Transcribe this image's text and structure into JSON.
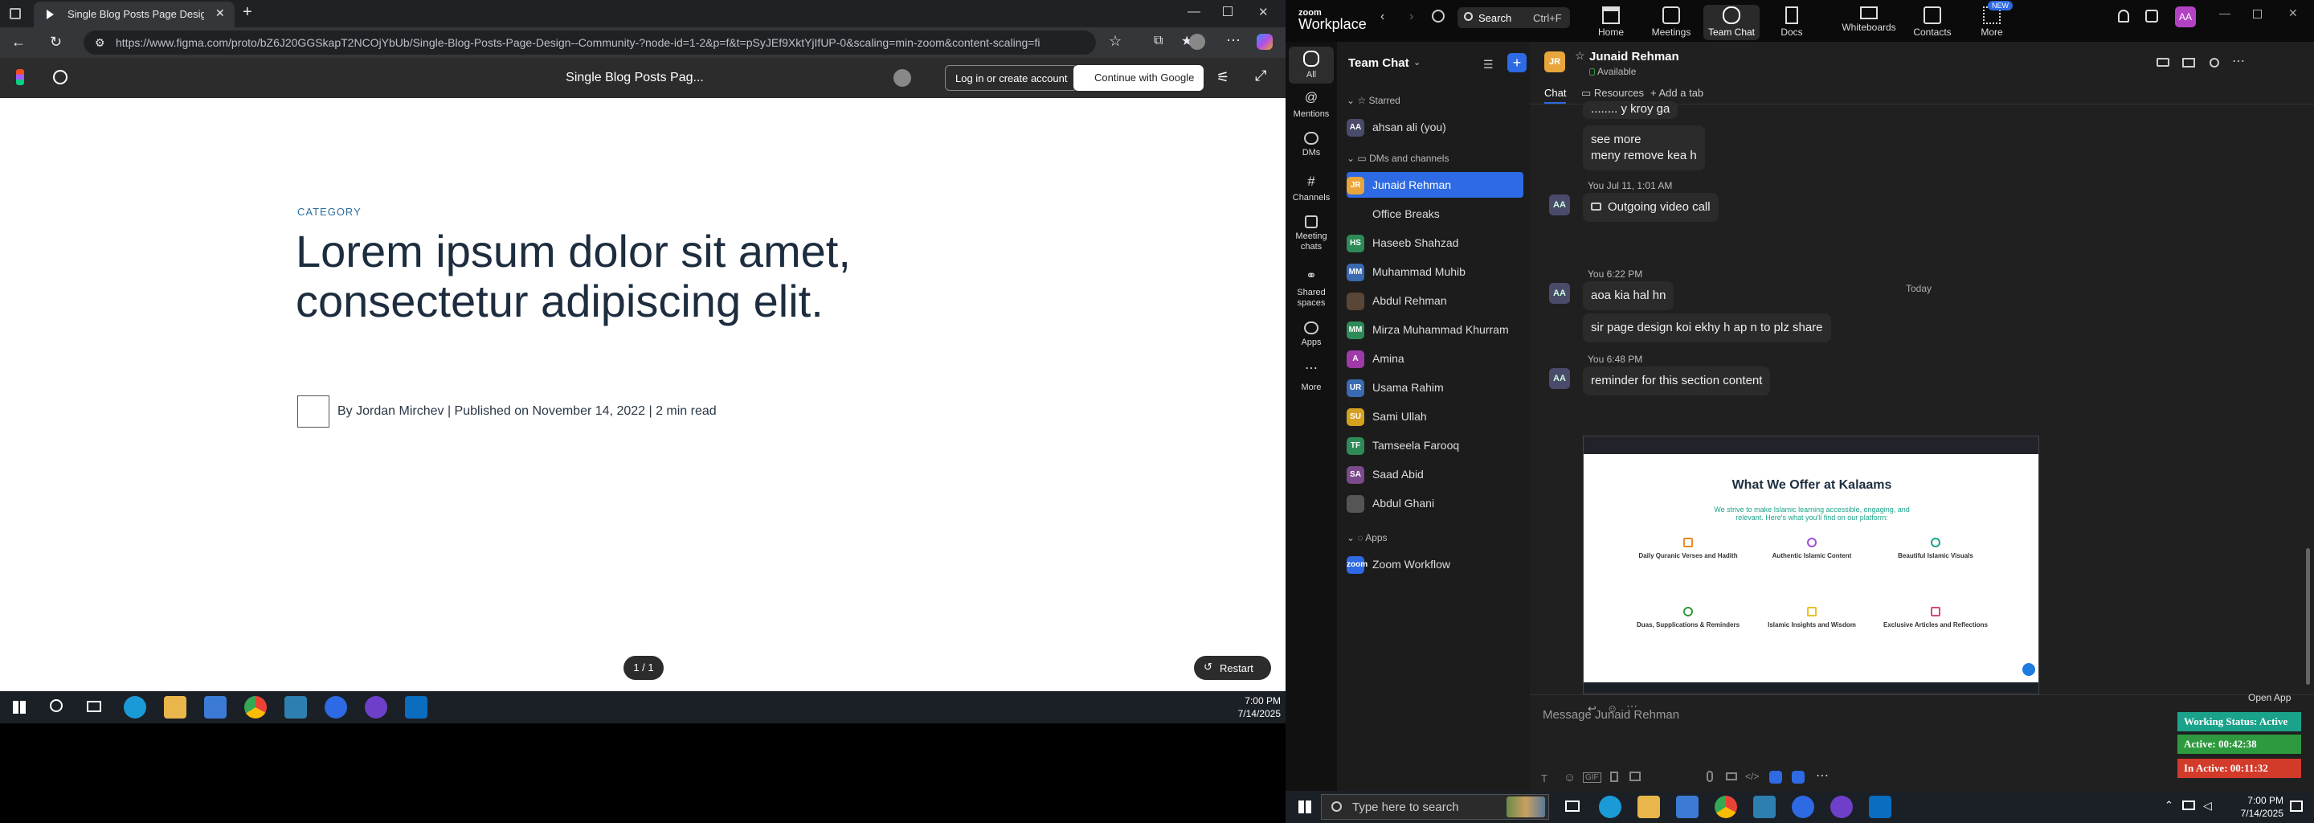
{
  "browser": {
    "tab_title": "Single Blog Posts Page Design (C",
    "url": "https://www.figma.com/proto/bZ6J20GGSkapT2NCOjYbUb/Single-Blog-Posts-Page-Design--Community-?node-id=1-2&p=f&t=pSyJEf9XktYjIfUP-0&scaling=min-zoom&content-scaling=fi",
    "figma_title": "Single Blog Posts Pag...",
    "login_label": "Log in or create account",
    "google_label": "Continue with Google"
  },
  "blog": {
    "category": "CATEGORY",
    "headline": "Lorem ipsum dolor sit amet, consectetur adipiscing elit.",
    "byline": "By Jordan Mirchev  |  Published on November 14, 2022  |  2 min read",
    "pager": "1 / 1",
    "restart": "Restart"
  },
  "left_taskbar": {
    "time": "7:00 PM",
    "date": "7/14/2025"
  },
  "zoom": {
    "logo_top": "zoom",
    "logo_bottom": "Workplace",
    "search_label": "Search",
    "search_shortcut": "Ctrl+F",
    "tabs": [
      {
        "label": "Home"
      },
      {
        "label": "Meetings"
      },
      {
        "label": "Team Chat"
      },
      {
        "label": "Docs"
      },
      {
        "label": "Whiteboards"
      },
      {
        "label": "Contacts"
      },
      {
        "label": "More"
      }
    ],
    "new_badge": "NEW",
    "user_initials": "AA",
    "rail": [
      {
        "label": "All"
      },
      {
        "label": "Mentions"
      },
      {
        "label": "DMs"
      },
      {
        "label": "Channels"
      },
      {
        "label": "Meeting chats"
      },
      {
        "label": "Shared spaces"
      },
      {
        "label": "Apps"
      },
      {
        "label": "More"
      }
    ],
    "list_title": "Team Chat",
    "sections": {
      "starred": "Starred",
      "dms": "DMs and channels",
      "apps": "Apps"
    },
    "starred_items": [
      {
        "name": "ahsan ali (you)",
        "initials": "AA",
        "color": "#4a4a6a"
      }
    ],
    "dm_items": [
      {
        "name": "Junaid Rehman",
        "initials": "JR",
        "color": "#e8a53c"
      },
      {
        "name": "Office Breaks",
        "initials": "",
        "color": "#1c1c1c"
      },
      {
        "name": "Haseeb Shahzad",
        "initials": "HS",
        "color": "#2e8b57"
      },
      {
        "name": "Muhammad Muhib",
        "initials": "MM",
        "color": "#3a6ab0"
      },
      {
        "name": "Abdul Rehman",
        "initials": "",
        "color": "#5a4636"
      },
      {
        "name": "Mirza Muhammad Khurram",
        "initials": "MM",
        "color": "#2e8b57"
      },
      {
        "name": "Amina",
        "initials": "A",
        "color": "#a03aa8"
      },
      {
        "name": "Usama Rahim",
        "initials": "UR",
        "color": "#3a6ab0"
      },
      {
        "name": "Sami Ullah",
        "initials": "SU",
        "color": "#d4a020"
      },
      {
        "name": "Tamseela Farooq",
        "initials": "TF",
        "color": "#2e8b57"
      },
      {
        "name": "Saad Abid",
        "initials": "SA",
        "color": "#7a4a8a"
      },
      {
        "name": "Abdul Ghani",
        "initials": "",
        "color": "#555"
      }
    ],
    "app_items": [
      {
        "name": "Zoom Workflow",
        "initials": "zoom",
        "color": "#2d6ae3"
      }
    ],
    "chat": {
      "contact_initials": "JR",
      "contact_name": "Junaid Rehman",
      "contact_status": "Available",
      "tabs": [
        "Chat",
        "Resources",
        "Add a tab"
      ],
      "msg_cut": "........ y kroy ga",
      "msg_see_more": "see more\nmeny remove kea h",
      "time_1": "You Jul 11, 1:01 AM",
      "video_call": "Outgoing video call",
      "today": "Today",
      "time_2": "You 6:22 PM",
      "msg_a": "aoa kia hal hn",
      "msg_b": "sir page design koi ekhy h ap n to plz share",
      "time_3": "You 6:48 PM",
      "msg_c": "reminder for this section content",
      "shot": {
        "title": "What We Offer at Kalaams",
        "subtitle": "We strive to make Islamic learning accessible, engaging, and relevant. Here's what you'll find on our platform:",
        "features": [
          "Daily Quranic Verses and Hadith",
          "Authentic Islamic Content",
          "Beautiful Islamic Visuals",
          "Duas, Supplications & Reminders",
          "Islamic Insights and Wisdom",
          "Exclusive Articles and Reflections"
        ]
      },
      "placeholder": "Message Junaid Rehman",
      "open_app": "Open App"
    },
    "status": {
      "working": "Working Status: Active",
      "active": "Active: 00:42:38",
      "inactive": "In Active: 00:11:32"
    }
  },
  "right_taskbar": {
    "search_placeholder": "Type here to search",
    "time": "7:00 PM",
    "date": "7/14/2025"
  },
  "colors": {
    "accent": "#2d6ae3",
    "working": "#1aa38a",
    "active": "#2e9a3f",
    "inactive": "#d23a2a"
  }
}
